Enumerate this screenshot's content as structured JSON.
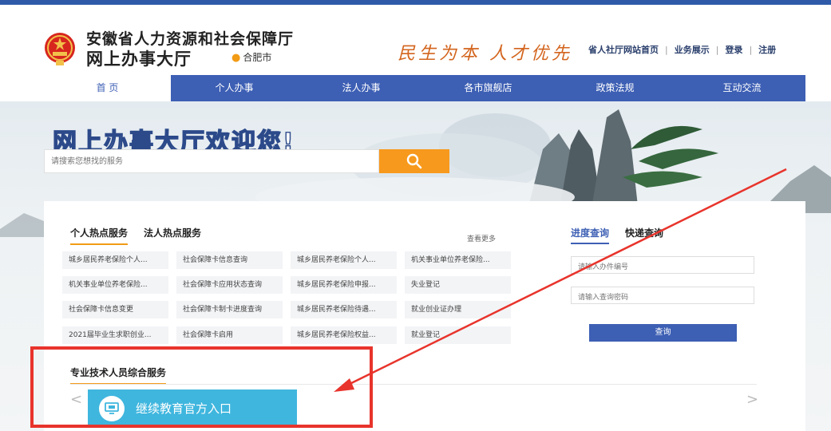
{
  "header": {
    "title_line1": "安徽省人力资源和社会保障厅",
    "title_line2": "网上办事大厅",
    "city": "合肥市",
    "slogan": "民生为本 人才优先",
    "links": [
      "省人社厅网站首页",
      "业务展示",
      "登录",
      "注册"
    ]
  },
  "nav": {
    "items": [
      "首 页",
      "个人办事",
      "法人办事",
      "各市旗舰店",
      "政策法规",
      "互动交流"
    ],
    "active_index": 0
  },
  "hero": {
    "welcome": "网上办事大厅欢迎您!",
    "search_placeholder": "请搜索您想找的服务"
  },
  "services": {
    "tabs": [
      "个人热点服务",
      "法人热点服务"
    ],
    "more": "查看更多",
    "items": [
      "城乡居民养老保险个人...",
      "社会保障卡信息查询",
      "城乡居民养老保险个人...",
      "机关事业单位养老保险...",
      "机关事业单位养老保险...",
      "社会保障卡应用状态查询",
      "城乡居民养老保险申报...",
      "失业登记",
      "社会保障卡信息变更",
      "社会保障卡制卡进度查询",
      "城乡居民养老保险待遇...",
      "就业创业证办理",
      "2021届毕业生求职创业...",
      "社会保障卡启用",
      "城乡居民养老保险权益...",
      "就业登记"
    ]
  },
  "query": {
    "tabs": [
      "进度查询",
      "快递查询"
    ],
    "case_placeholder": "请输入办件编号",
    "password_placeholder": "请输入查询密码",
    "button": "查询"
  },
  "professional": {
    "title": "专业技术人员综合服务",
    "entry_label": "继续教育官方入口",
    "prev": "<",
    "next": ">"
  },
  "colors": {
    "brand_blue": "#3d5fb4",
    "accent_orange": "#f7991c",
    "entry_cyan": "#3fb6de",
    "annotation_red": "#e8342c"
  }
}
